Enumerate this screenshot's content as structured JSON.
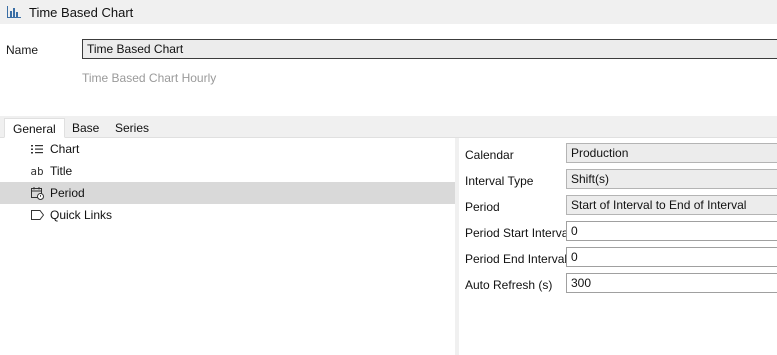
{
  "window": {
    "title": "Time Based Chart",
    "icon": "bar-chart-icon"
  },
  "name_field": {
    "label": "Name",
    "value": "Time Based Chart"
  },
  "description": "Time Based Chart Hourly",
  "tabs": [
    {
      "label": "General",
      "active": true
    },
    {
      "label": "Base",
      "active": false
    },
    {
      "label": "Series",
      "active": false
    }
  ],
  "tree": [
    {
      "label": "Chart",
      "icon": "list-icon",
      "selected": false
    },
    {
      "label": "Title",
      "icon": "text-ab-icon",
      "selected": false
    },
    {
      "label": "Period",
      "icon": "calendar-clock-icon",
      "selected": true
    },
    {
      "label": "Quick Links",
      "icon": "tag-icon",
      "selected": false
    }
  ],
  "properties": [
    {
      "label": "Calendar",
      "value": "Production",
      "editable": false
    },
    {
      "label": "Interval Type",
      "value": "Shift(s)",
      "editable": false
    },
    {
      "label": "Period",
      "value": "Start of Interval to End of Interval",
      "editable": false
    },
    {
      "label": "Period Start Intervals",
      "value": "0",
      "editable": true
    },
    {
      "label": "Period End Intervals",
      "value": "0",
      "editable": true
    },
    {
      "label": "Auto Refresh (s)",
      "value": "300",
      "editable": true
    }
  ]
}
